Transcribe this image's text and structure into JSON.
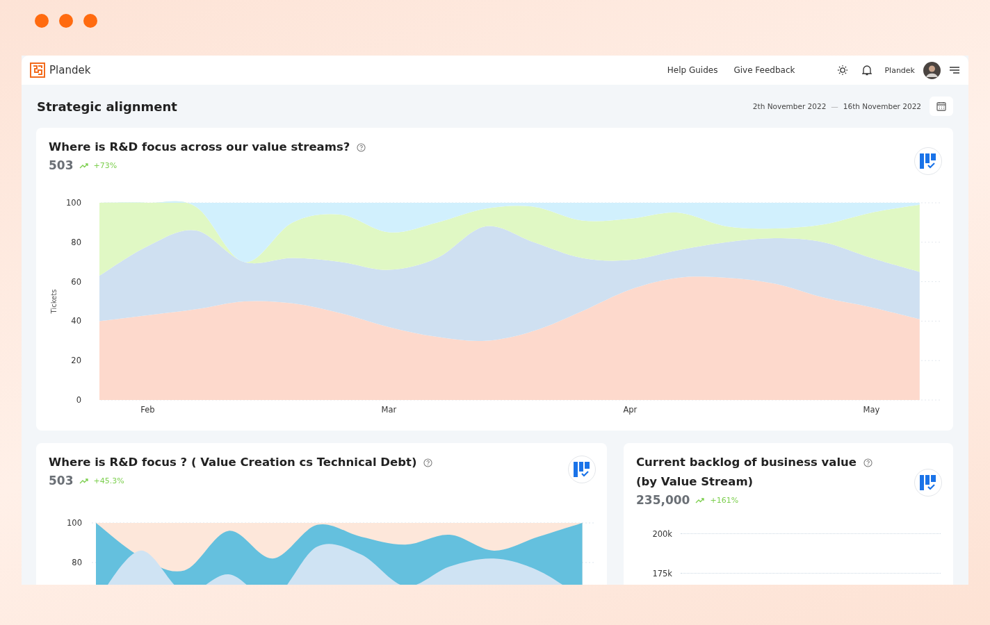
{
  "brand": {
    "name": "Plandek"
  },
  "nav": {
    "links": [
      "Help Guides",
      "Give Feedback"
    ],
    "user": "Plandek"
  },
  "page": {
    "title": "Strategic alignment",
    "date_from": "2th November 2022",
    "date_separator": "—",
    "date_to": "16th November 2022"
  },
  "cards": [
    {
      "kind": "chart",
      "title": "Where is R&D focus across our value streams?",
      "value": "503",
      "change": "+73%",
      "chart_data": {
        "type": "area",
        "stacked": true,
        "grid": true,
        "ylabel": "Tickets",
        "categories": [
          null,
          "Feb",
          null,
          null,
          null,
          null,
          "Mar",
          null,
          null,
          null,
          null,
          "Apr",
          null,
          null,
          null,
          null,
          "May",
          null
        ],
        "yticks": [
          0,
          20,
          40,
          60,
          80,
          100
        ],
        "ylim": [
          0,
          100
        ],
        "series": [
          {
            "color": "#fdd9cc",
            "values": [
              40,
              43,
              46,
              50,
              49,
              44,
              37,
              32,
              30,
              35,
              45,
              56,
              62,
              62,
              59,
              52,
              47,
              41
            ]
          },
          {
            "color": "#cfe0f1",
            "values": [
              23,
              35,
              40,
              20,
              23,
              26,
              29,
              40,
              58,
              45,
              27,
              15,
              14,
              18,
              23,
              28,
              25,
              24
            ]
          },
          {
            "color": "#e0f8c4",
            "values": [
              37,
              22,
              12,
              0,
              18,
              24,
              19,
              18,
              9,
              18,
              19,
              21,
              19,
              8,
              5,
              9,
              23,
              34
            ]
          },
          {
            "color": "#d1f0fd",
            "values": [
              0,
              0,
              2,
              30,
              10,
              6,
              15,
              10,
              3,
              2,
              9,
              8,
              5,
              12,
              13,
              11,
              5,
              1
            ]
          }
        ]
      }
    },
    {
      "kind": "drawing",
      "title": "Where is R&D focus ? ( Value Creation cs Technical Debt)",
      "value": "503",
      "change": "+45.3%",
      "y_axis_labels": [
        "100",
        "80"
      ]
    },
    {
      "kind": "axis",
      "title": "Current backlog of business value",
      "title_line_2": "(by Value Stream)",
      "value": "235,000",
      "change": "+161%",
      "y_axis_labels": [
        "200k",
        "175k"
      ]
    }
  ]
}
